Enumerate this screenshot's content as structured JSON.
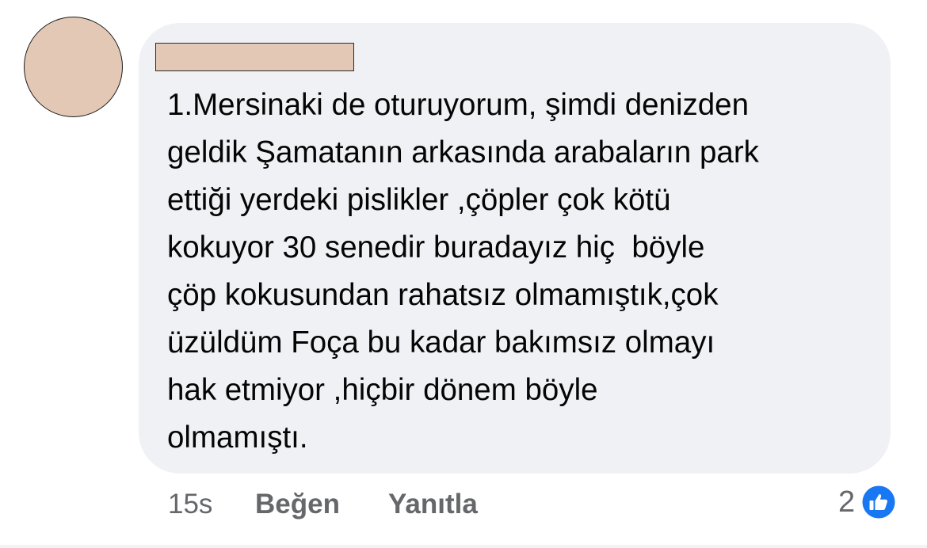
{
  "comment": {
    "text_lines": [
      "1.Mersinaki de oturuyorum, şimdi denizden",
      "geldik Şamatanın arkasında arabaların park",
      "ettiği yerdeki pislikler ,çöpler çok kötü",
      "kokuyor 30 senedir buradayız hiç  böyle",
      "çöp kokusundan rahatsız olmamıştık,çok",
      "üzüldüm Foça bu kadar bakımsız olmayı",
      "hak etmiyor ,hiçbir dönem böyle",
      "olmamıştı."
    ]
  },
  "actions": {
    "time": "15s",
    "like_label": "Beğen",
    "reply_label": "Yanıtla"
  },
  "reactions": {
    "count": "2",
    "icon": "thumbs-up-icon",
    "icon_color": "#1877f2"
  },
  "colors": {
    "bubble": "#eff1f4",
    "redaction": "#e3c9b5",
    "text": "#050505",
    "secondary_text": "#65676b"
  }
}
